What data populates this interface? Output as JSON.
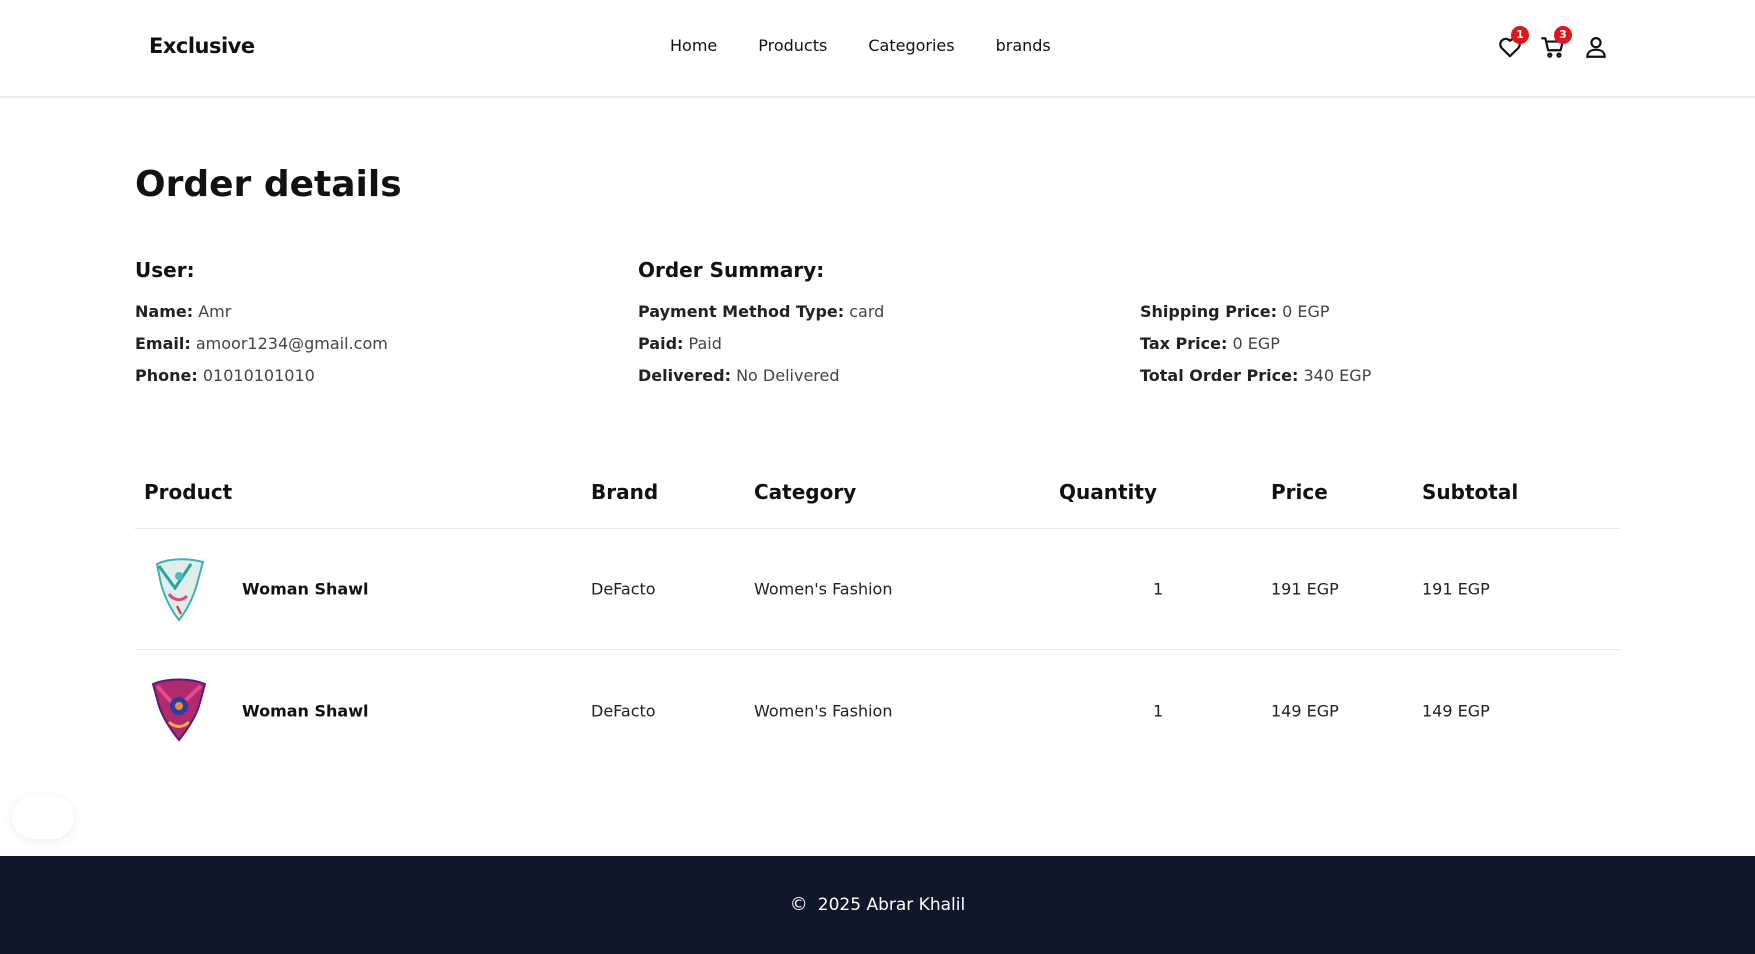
{
  "header": {
    "brand": "Exclusive",
    "nav": [
      "Home",
      "Products",
      "Categories",
      "brands"
    ],
    "wishlist_count": "1",
    "cart_count": "3",
    "icons": [
      "heart-icon",
      "cart-icon",
      "user-icon"
    ]
  },
  "main": {
    "title": "Order details",
    "user": {
      "heading": "User:",
      "name_label": "Name:",
      "name": "Amr",
      "email_label": "Email:",
      "email": "amoor1234@gmail.com",
      "phone_label": "Phone:",
      "phone": "01010101010"
    },
    "summary": {
      "heading": "Order Summary:",
      "payment_label": "Payment Method Type:",
      "payment": "card",
      "paid_label": "Paid:",
      "paid": "Paid",
      "delivered_label": "Delivered:",
      "delivered": "No Delivered",
      "shipping_label": "Shipping Price:",
      "shipping": "0 EGP",
      "tax_label": "Tax Price:",
      "tax": "0 EGP",
      "total_label": "Total Order Price:",
      "total": "340 EGP"
    },
    "table": {
      "headers": [
        "Product",
        "Brand",
        "Category",
        "Quantity",
        "Price",
        "Subtotal"
      ],
      "rows": [
        {
          "product": "Woman Shawl",
          "brand": "DeFacto",
          "category": "Women's Fashion",
          "quantity": "1",
          "price": "191 EGP",
          "subtotal": "191 EGP"
        },
        {
          "product": "Woman Shawl",
          "brand": "DeFacto",
          "category": "Women's Fashion",
          "quantity": "1",
          "price": "149 EGP",
          "subtotal": "149 EGP"
        }
      ]
    }
  },
  "footer": {
    "copyright_symbol": "©",
    "text": "2025 Abrar Khalil"
  },
  "colors": {
    "badge": "#e0161e",
    "footer_bg": "#0f172a"
  }
}
